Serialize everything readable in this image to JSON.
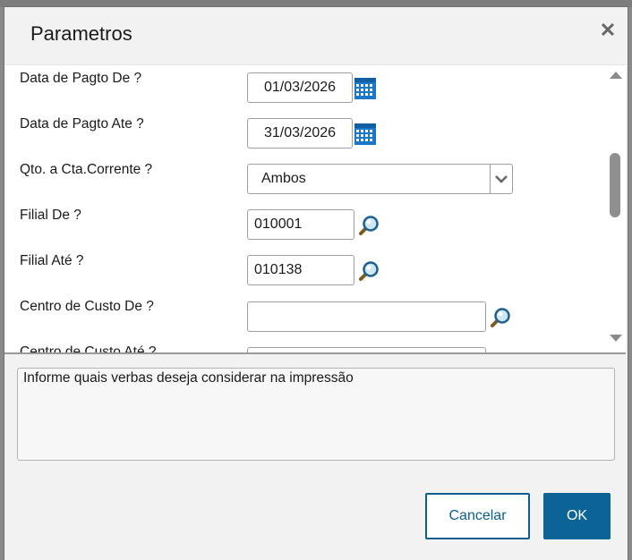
{
  "dialog": {
    "title": "Parametros",
    "close_icon": "close-icon"
  },
  "fields": [
    {
      "label": "Data de Pagto De ?",
      "value": "01/03/2026",
      "type": "date"
    },
    {
      "label": "Data de Pagto Ate ?",
      "value": "31/03/2026",
      "type": "date"
    },
    {
      "label": "Qto. a Cta.Corrente ?",
      "value": "Ambos",
      "type": "select"
    },
    {
      "label": "Filial De ?",
      "value": "010001",
      "type": "lookup"
    },
    {
      "label": "Filial Até ?",
      "value": "010138",
      "type": "lookup"
    },
    {
      "label": "Centro de Custo De ?",
      "value": "",
      "type": "lookup"
    },
    {
      "label": "Centro de Custo Até ?",
      "value": "",
      "type": "lookup"
    }
  ],
  "help_text": "Informe quais verbas deseja considerar na impressão",
  "buttons": {
    "cancel": "Cancelar",
    "ok": "OK"
  },
  "colors": {
    "primary": "#0b6396",
    "calendar_icon": "#1b78c8"
  }
}
